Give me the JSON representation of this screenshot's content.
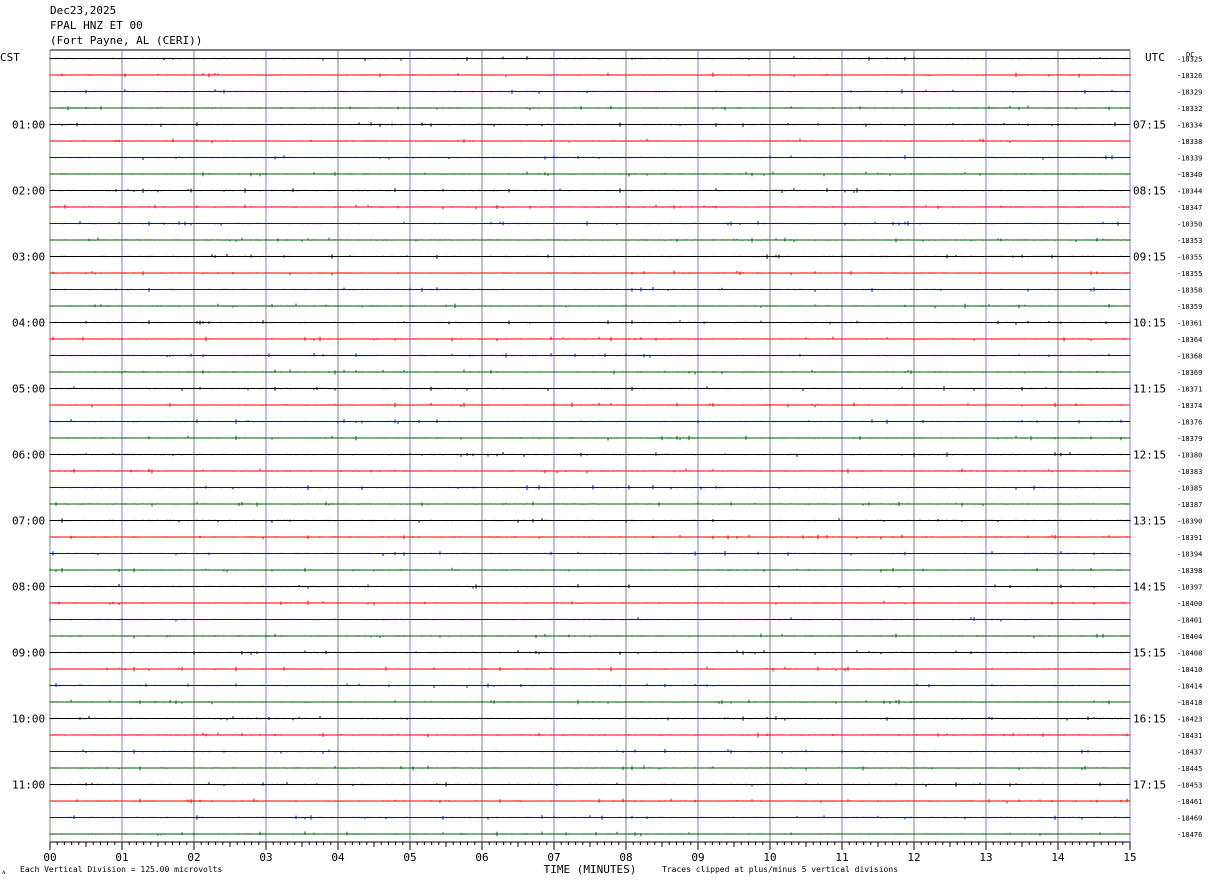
{
  "header": {
    "date": "Dec23,2025",
    "station": "FPAL HNZ ET 00",
    "location": "(Fort Payne, AL (CERI))"
  },
  "left_tz": "CST",
  "right_tz": "UTC",
  "dc_label": "DC",
  "footer": {
    "scale": "Each Vertical Division =  125.00 microvolts",
    "clip": "Traces clipped at plus/minus 5 vertical divisions",
    "corner": "ᴀ"
  },
  "colors": {
    "black": "#000000",
    "red": "#ff0000",
    "blue": "#0000ff",
    "green": "#006400",
    "grid": "#808080",
    "gridblue": "#8080c0"
  },
  "chart_data": {
    "type": "line",
    "title": "",
    "xlabel": "TIME (MINUTES)",
    "ylabel": "",
    "xlim": [
      0,
      15
    ],
    "x_tick_labels": [
      "00",
      "01",
      "02",
      "03",
      "04",
      "05",
      "06",
      "07",
      "08",
      "09",
      "10",
      "11",
      "12",
      "13",
      "14",
      "15"
    ],
    "rows_per_hour": 4,
    "left_hour_labels": [
      "01:00",
      "02:00",
      "03:00",
      "04:00",
      "05:00",
      "06:00",
      "07:00",
      "08:00",
      "09:00",
      "10:00",
      "11:00"
    ],
    "right_hour_labels": [
      "07:15",
      "08:15",
      "09:15",
      "10:15",
      "11:15",
      "12:15",
      "13:15",
      "14:15",
      "15:15",
      "16:15",
      "17:15"
    ],
    "dc_offsets": [
      "-18325",
      "-18326",
      "-18329",
      "-18332",
      "-18334",
      "-18338",
      "-18339",
      "-18340",
      "-18344",
      "-18347",
      "-18350",
      "-18353",
      "-18355",
      "-18355",
      "-18358",
      "-18359",
      "-18361",
      "-18364",
      "-18368",
      "-18369",
      "-18371",
      "-18374",
      "-18376",
      "-18379",
      "-18380",
      "-18383",
      "-18385",
      "-18387",
      "-18390",
      "-18391",
      "-18394",
      "-18398",
      "-18397",
      "-18400",
      "-18401",
      "-18404",
      "-18408",
      "-18410",
      "-18414",
      "-18418",
      "-18423",
      "-18431",
      "-18437",
      "-18445",
      "-18453",
      "-18461",
      "-18469",
      "-18476"
    ],
    "row_colors": [
      "black",
      "red",
      "blue",
      "green"
    ],
    "clip_divisions": 5,
    "microvolts_per_division": 125.0
  }
}
